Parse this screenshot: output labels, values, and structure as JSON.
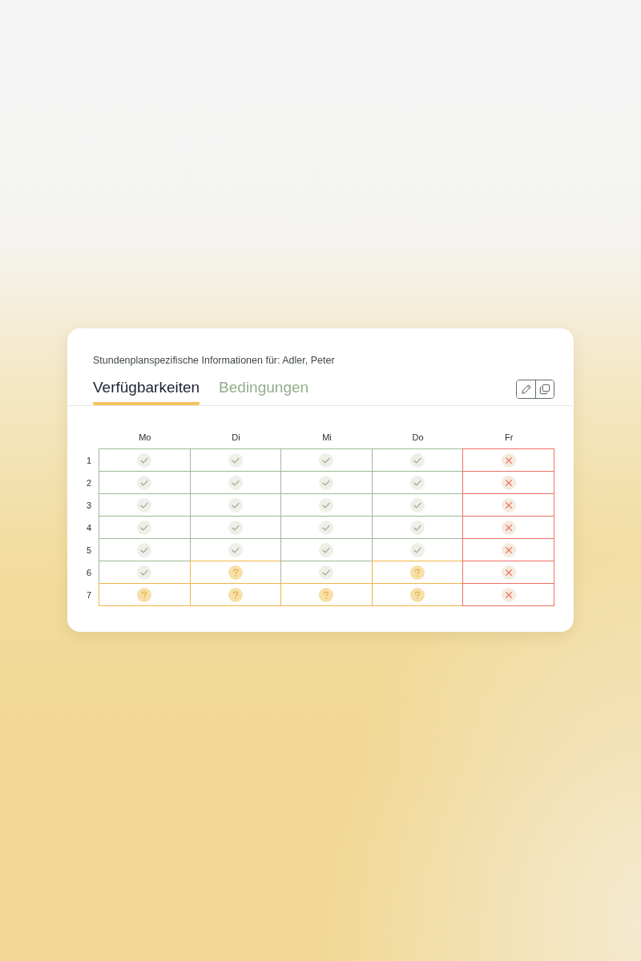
{
  "header": {
    "title": "Stundenplanspezifische Informationen für: Adler, Peter"
  },
  "tabs": [
    {
      "label": "Verfügbarkeiten",
      "selected": true
    },
    {
      "label": "Bedingungen",
      "selected": false
    }
  ],
  "toolbar": [
    {
      "kind": "edit"
    },
    {
      "kind": "copy"
    }
  ],
  "grid": {
    "columns": [
      "Mo",
      "Di",
      "Mi",
      "Do",
      "Fr"
    ],
    "rows": [
      {
        "label": "1",
        "cells": [
          {
            "kind": "yes"
          },
          {
            "kind": "yes"
          },
          {
            "kind": "yes"
          },
          {
            "kind": "yes"
          },
          {
            "kind": "no"
          }
        ]
      },
      {
        "label": "2",
        "cells": [
          {
            "kind": "yes"
          },
          {
            "kind": "yes"
          },
          {
            "kind": "yes"
          },
          {
            "kind": "yes"
          },
          {
            "kind": "no"
          }
        ]
      },
      {
        "label": "3",
        "cells": [
          {
            "kind": "yes"
          },
          {
            "kind": "yes"
          },
          {
            "kind": "yes"
          },
          {
            "kind": "yes"
          },
          {
            "kind": "no"
          }
        ]
      },
      {
        "label": "4",
        "cells": [
          {
            "kind": "yes"
          },
          {
            "kind": "yes"
          },
          {
            "kind": "yes"
          },
          {
            "kind": "yes"
          },
          {
            "kind": "no"
          }
        ]
      },
      {
        "label": "5",
        "cells": [
          {
            "kind": "yes"
          },
          {
            "kind": "yes"
          },
          {
            "kind": "yes"
          },
          {
            "kind": "yes"
          },
          {
            "kind": "no"
          }
        ]
      },
      {
        "label": "6",
        "cells": [
          {
            "kind": "yes"
          },
          {
            "kind": "maybe"
          },
          {
            "kind": "yes"
          },
          {
            "kind": "maybe"
          },
          {
            "kind": "no"
          }
        ]
      },
      {
        "label": "7",
        "cells": [
          {
            "kind": "maybe"
          },
          {
            "kind": "maybe"
          },
          {
            "kind": "maybe"
          },
          {
            "kind": "maybe"
          },
          {
            "kind": "no"
          }
        ]
      }
    ]
  }
}
